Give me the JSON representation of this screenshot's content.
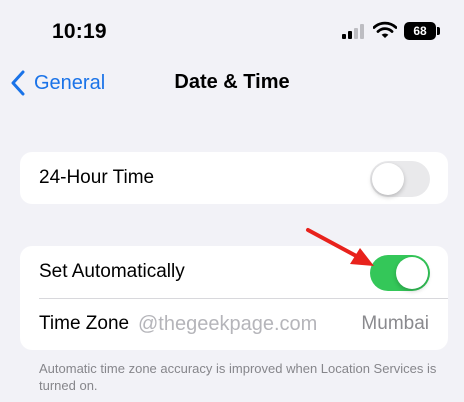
{
  "status_bar": {
    "time": "10:19",
    "battery_level": "68"
  },
  "nav": {
    "back_label": "General",
    "title": "Date & Time"
  },
  "settings": {
    "hour24": {
      "label": "24-Hour Time",
      "enabled": false
    },
    "set_automatically": {
      "label": "Set Automatically",
      "enabled": true
    },
    "time_zone": {
      "label": "Time Zone",
      "value": "Mumbai"
    }
  },
  "watermark": "@thegeekpage.com",
  "footnote": "Automatic time zone accuracy is improved when Location Services is turned on.",
  "colors": {
    "accent": "#1a73e8",
    "toggle_on": "#34c759",
    "toggle_off": "#e9e9eb",
    "arrow": "#e8221c"
  },
  "icons": [
    "cellular-signal-icon",
    "wifi-icon",
    "battery-icon",
    "chevron-left-icon",
    "red-arrow-annotation"
  ]
}
